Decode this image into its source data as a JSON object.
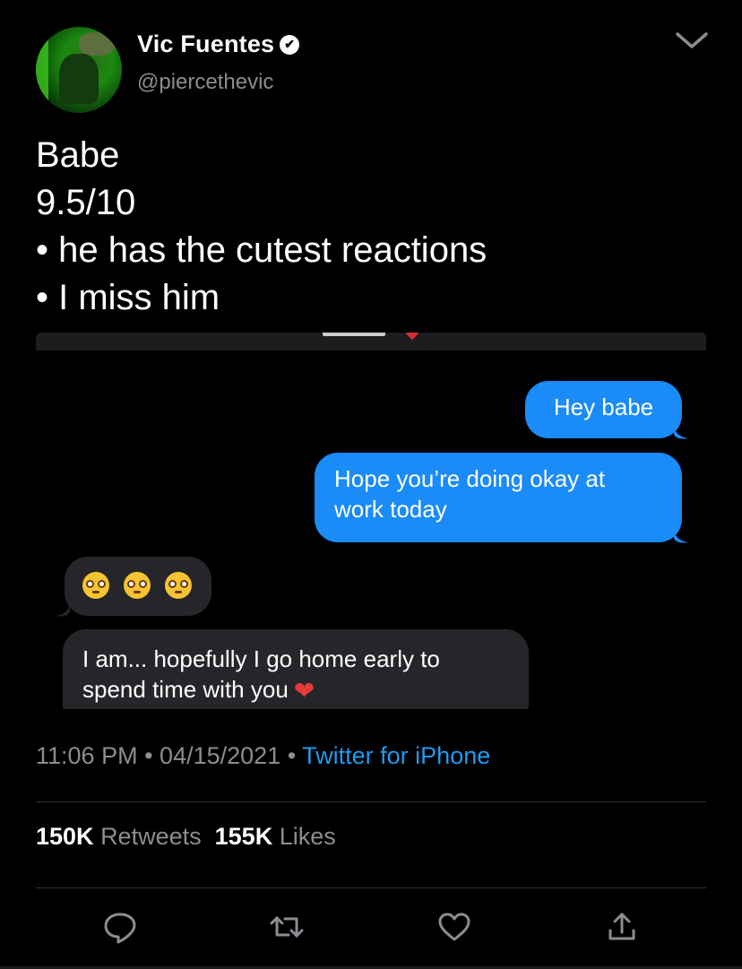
{
  "author": {
    "name": "Vic Fuentes",
    "handle": "@piercethevic",
    "verified_mark": "✔"
  },
  "tweet": {
    "lines": [
      "Babe",
      "9.5/10",
      "• he has the cutest reactions",
      "• I miss him"
    ]
  },
  "screenshot": {
    "messages": [
      {
        "from": "me",
        "text": "Hey babe"
      },
      {
        "from": "me",
        "text": "Hope you’re doing okay at\nwork today"
      },
      {
        "from": "them",
        "text": "🥺🥺🥺"
      },
      {
        "from": "them",
        "text": "I am... hopefully I go home early to\nspend time with you",
        "trailing_emoji": "❤"
      }
    ],
    "colors": {
      "sent": "#1a8bf7",
      "received": "#26262a"
    }
  },
  "meta": {
    "time": "11:06 PM",
    "sep1": " • ",
    "date": "04/15/2021",
    "sep2": " • ",
    "source": "Twitter for iPhone"
  },
  "stats": {
    "retweets_count": "150K",
    "retweets_label": "Retweets",
    "likes_count": "155K",
    "likes_label": "Likes"
  },
  "actions": {
    "icons": [
      "reply-icon",
      "retweet-icon",
      "like-icon",
      "share-icon"
    ]
  },
  "colors": {
    "link": "#1d9bf0",
    "muted": "#8a8d91",
    "background": "#000000"
  }
}
